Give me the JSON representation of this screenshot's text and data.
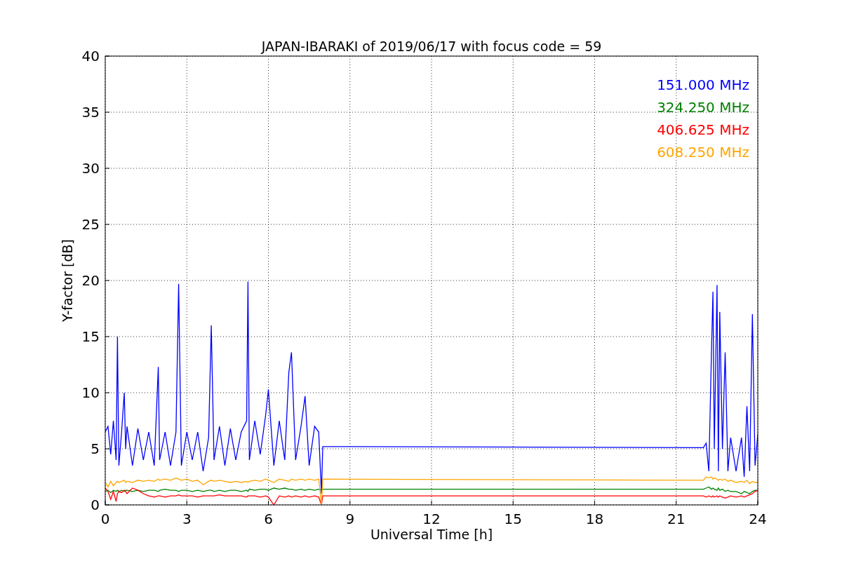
{
  "chart_data": {
    "type": "line",
    "title": "JAPAN-IBARAKI of 2019/06/17 with focus code = 59",
    "xlabel": "Universal Time [h]",
    "ylabel": "Y-factor [dB]",
    "x": [
      0,
      0.1,
      0.2,
      0.3,
      0.4,
      0.45,
      0.5,
      0.6,
      0.7,
      0.75,
      0.8,
      1.0,
      1.2,
      1.4,
      1.6,
      1.8,
      1.95,
      2.0,
      2.2,
      2.4,
      2.6,
      2.7,
      2.8,
      3.0,
      3.2,
      3.4,
      3.6,
      3.8,
      3.9,
      4.0,
      4.2,
      4.4,
      4.6,
      4.8,
      5.0,
      5.2,
      5.25,
      5.3,
      5.5,
      5.7,
      5.9,
      6.0,
      6.2,
      6.4,
      6.6,
      6.75,
      6.85,
      7.0,
      7.2,
      7.35,
      7.5,
      7.7,
      7.85,
      7.95,
      8.0,
      22.0,
      22.1,
      22.2,
      22.3,
      22.35,
      22.4,
      22.5,
      22.55,
      22.6,
      22.7,
      22.8,
      22.9,
      23.0,
      23.2,
      23.4,
      23.5,
      23.6,
      23.7,
      23.8,
      23.9,
      24.0
    ],
    "series": [
      {
        "name": "151.000 MHz",
        "color": "#0000ff",
        "values": [
          6.5,
          7,
          4.5,
          7.5,
          4,
          15,
          3.5,
          6.5,
          10,
          5,
          7,
          3.5,
          6.8,
          4,
          6.5,
          3.5,
          12.3,
          4,
          6.5,
          3.5,
          6.5,
          19.7,
          3.5,
          6.5,
          4,
          6.5,
          3,
          6,
          16,
          4,
          7,
          3.5,
          6.8,
          4,
          6.5,
          7.5,
          19.9,
          4,
          7.5,
          4.5,
          8,
          10.3,
          3.5,
          7.5,
          4,
          11.8,
          13.6,
          4,
          7,
          9.7,
          3.5,
          7,
          6.5,
          1,
          5.2,
          5.1,
          5.5,
          3,
          14,
          19,
          5,
          19.6,
          3,
          17.2,
          5,
          13.6,
          3,
          6,
          3,
          6,
          2.5,
          8.8,
          3,
          17,
          3.5,
          6.3
        ]
      },
      {
        "name": "324.250 MHz",
        "color": "#008000",
        "values": [
          1.2,
          1.3,
          1.1,
          1.3,
          1.2,
          1.3,
          1.2,
          1.3,
          1.2,
          1.3,
          1.3,
          1.2,
          1.3,
          1.2,
          1.3,
          1.3,
          1.2,
          1.3,
          1.4,
          1.3,
          1.3,
          1.2,
          1.3,
          1.3,
          1.2,
          1.3,
          1.2,
          1.3,
          1.3,
          1.2,
          1.3,
          1.2,
          1.3,
          1.3,
          1.2,
          1.3,
          1.2,
          1.4,
          1.3,
          1.4,
          1.4,
          1.3,
          1.5,
          1.4,
          1.5,
          1.4,
          1.4,
          1.3,
          1.4,
          1.3,
          1.4,
          1.3,
          1.4,
          1.3,
          1.4,
          1.4,
          1.5,
          1.6,
          1.4,
          1.5,
          1.4,
          1.3,
          1.5,
          1.3,
          1.4,
          1.2,
          1.3,
          1.2,
          1.2,
          1.0,
          1.2,
          1.1,
          1.0,
          1.2,
          1.3,
          1.3
        ]
      },
      {
        "name": "406.625 MHz",
        "color": "#ff0000",
        "values": [
          1.5,
          1.2,
          0.5,
          1.2,
          0.3,
          1.0,
          1.2,
          1.1,
          1.3,
          1.2,
          1.0,
          1.5,
          1.3,
          1.0,
          0.8,
          0.7,
          0.8,
          0.8,
          0.7,
          0.8,
          0.8,
          0.9,
          0.8,
          0.8,
          0.8,
          0.7,
          0.8,
          0.8,
          0.8,
          0.8,
          0.9,
          0.8,
          0.8,
          0.8,
          0.8,
          0.7,
          0.8,
          0.8,
          0.8,
          0.7,
          0.8,
          0.7,
          0,
          0.8,
          0.7,
          0.8,
          0.7,
          0.8,
          0.7,
          0.8,
          0.7,
          0.8,
          0.7,
          0,
          0.8,
          0.8,
          0.7,
          0.8,
          0.7,
          0.8,
          0.7,
          0.8,
          0.7,
          0.8,
          0.7,
          0.6,
          0.7,
          0.8,
          0.7,
          0.8,
          0.7,
          0.8,
          0.9,
          1.0,
          1.2,
          1.3
        ]
      },
      {
        "name": "608.250 MHz",
        "color": "#ffa500",
        "values": [
          2.0,
          1.6,
          2.1,
          1.7,
          2.0,
          2.1,
          2.0,
          2.1,
          2.2,
          2.0,
          2.1,
          2.0,
          2.2,
          2.1,
          2.2,
          2.1,
          2.3,
          2.2,
          2.3,
          2.2,
          2.4,
          2.3,
          2.2,
          2.3,
          2.1,
          2.2,
          1.8,
          2.1,
          2.2,
          2.1,
          2.2,
          2.1,
          2.0,
          2.1,
          2.0,
          2.1,
          2.0,
          2.1,
          2.2,
          2.1,
          2.3,
          2.2,
          2.0,
          2.3,
          2.2,
          2.1,
          2.3,
          2.2,
          2.3,
          2.2,
          2.3,
          2.2,
          2.3,
          0,
          2.3,
          2.2,
          2.5,
          2.4,
          2.5,
          2.3,
          2.4,
          2.3,
          2.2,
          2.3,
          2.2,
          2.3,
          2.1,
          2.2,
          2.0,
          2.1,
          2.0,
          2.2,
          1.9,
          2.1,
          2.0,
          2.0
        ]
      }
    ],
    "xlim": [
      0,
      24
    ],
    "ylim": [
      0,
      40
    ],
    "xticks": [
      0,
      3,
      6,
      9,
      12,
      15,
      18,
      21,
      24
    ],
    "yticks": [
      0,
      5,
      10,
      15,
      20,
      25,
      30,
      35,
      40
    ],
    "grid": true
  }
}
